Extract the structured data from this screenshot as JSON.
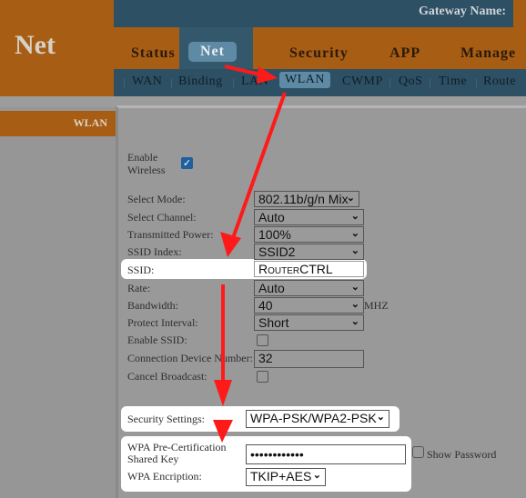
{
  "header": {
    "brand": "Net",
    "gateway_label": "Gateway Name:"
  },
  "main_nav": [
    {
      "label": "Status",
      "active": false
    },
    {
      "label": "Net",
      "active": true
    },
    {
      "label": "Security",
      "active": false
    },
    {
      "label": "APP",
      "active": false
    },
    {
      "label": "Manage",
      "active": false
    }
  ],
  "sub_nav": [
    {
      "label": "WAN"
    },
    {
      "label": "Binding"
    },
    {
      "label": "LAN"
    },
    {
      "label": "WLAN",
      "active": true
    },
    {
      "label": "CWMP"
    },
    {
      "label": "QoS"
    },
    {
      "label": "Time"
    },
    {
      "label": "Route"
    }
  ],
  "sidebar": {
    "active_item": "WLAN"
  },
  "form": {
    "enable_wireless": {
      "label_line1": "Enable",
      "label_line2": "Wireless",
      "checked": true
    },
    "select_mode": {
      "label": "Select Mode:",
      "value": "802.11b/g/n Mix"
    },
    "select_channel": {
      "label": "Select Channel:",
      "value": "Auto"
    },
    "transmitted_power": {
      "label": "Transmitted Power:",
      "value": "100%"
    },
    "ssid_index": {
      "label": "SSID Index:",
      "value": "SSID2"
    },
    "ssid": {
      "label": "SSID:",
      "value": "RouterCTRL"
    },
    "rate": {
      "label": "Rate:",
      "value": "Auto"
    },
    "bandwidth": {
      "label": "Bandwidth:",
      "value": "40",
      "unit": "MHZ"
    },
    "protect_interval": {
      "label": "Protect Interval:",
      "value": "Short"
    },
    "enable_ssid": {
      "label": "Enable SSID:",
      "checked": false
    },
    "connection_device_number": {
      "label": "Connection Device Number:",
      "value": "32"
    },
    "cancel_broadcast": {
      "label": "Cancel Broadcast:",
      "checked": false
    },
    "security_settings": {
      "label": "Security Settings:",
      "value": "WPA-PSK/WPA2-PSK"
    },
    "wpa_key": {
      "label_line1": "WPA Pre-Certification",
      "label_line2": "Shared Key",
      "value": "••••••••••••",
      "show_password_label": "Show Password",
      "show_password_checked": false
    },
    "wpa_encryption": {
      "label": "WPA Encription:",
      "value": "TKIP+AES"
    }
  },
  "colors": {
    "orange": "#a75d14",
    "navy": "#2e5064",
    "active_tab": "#5e8aa5",
    "arrow": "#ff1a1a"
  }
}
